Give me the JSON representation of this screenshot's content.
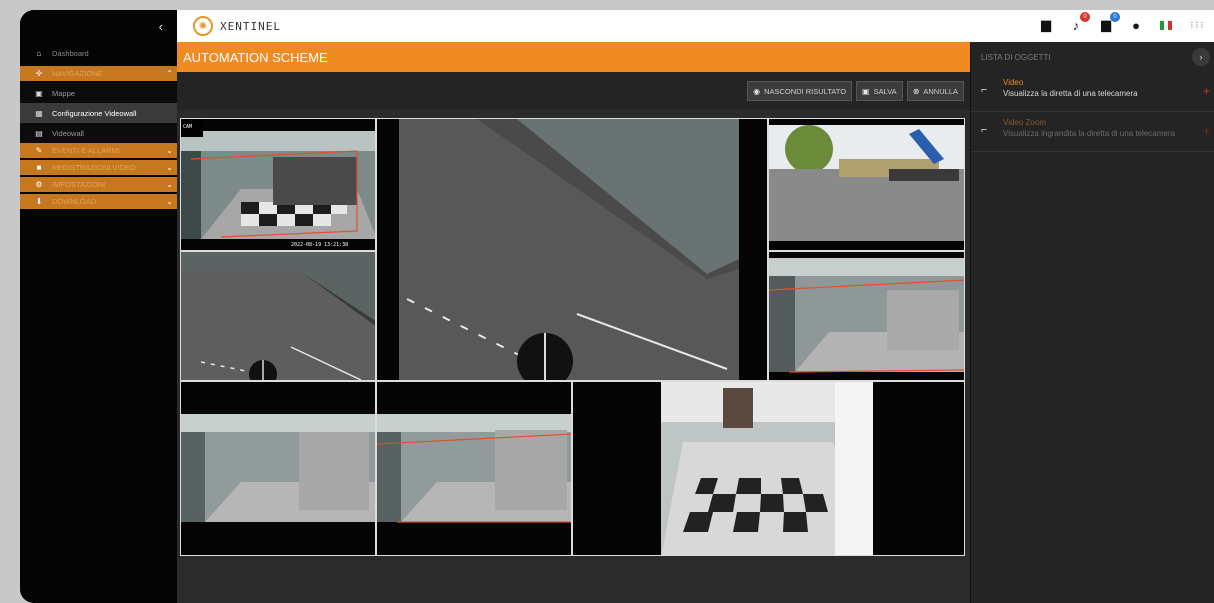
{
  "app": {
    "brand": "XENTINEL",
    "collapse_glyph": "‹"
  },
  "sidebar": {
    "items": [
      {
        "label": "Dashboard",
        "icon": "home-icon",
        "glyph": "⌂",
        "kind": "top"
      },
      {
        "label": "NAVIGAZIONE",
        "icon": "navigation-icon",
        "glyph": "✢",
        "kind": "section",
        "chev": "⌃"
      },
      {
        "label": "Mappe",
        "icon": "map-icon",
        "glyph": "▣",
        "kind": "sub"
      },
      {
        "label": "Configurazione Videowall",
        "icon": "videowall-config-icon",
        "glyph": "▦",
        "kind": "sub-active"
      },
      {
        "label": "Videowall",
        "icon": "videowall-icon",
        "glyph": "▤",
        "kind": "sub"
      },
      {
        "label": "EVENTI E ALLARMI",
        "icon": "events-icon",
        "glyph": "✎",
        "kind": "section",
        "chev": "⌄"
      },
      {
        "label": "REGISTRAZIONI VIDEO",
        "icon": "recordings-icon",
        "glyph": "■",
        "kind": "section",
        "chev": "⌄"
      },
      {
        "label": "IMPOSTAZIONI",
        "icon": "settings-icon",
        "glyph": "⚙",
        "kind": "section",
        "chev": "⌄"
      },
      {
        "label": "DOWNLOAD",
        "icon": "download-icon",
        "glyph": "⬇",
        "kind": "section",
        "chev": "⌄"
      }
    ]
  },
  "header": {
    "icons": [
      {
        "name": "briefcase-icon",
        "glyph": "▆"
      },
      {
        "name": "bell-icon",
        "glyph": "♪",
        "badge": "0",
        "badge_color": "#d9342b"
      },
      {
        "name": "notification-icon",
        "glyph": "▆",
        "badge": "0",
        "badge_color": "#2a78d4"
      },
      {
        "name": "user-icon",
        "glyph": "●"
      },
      {
        "name": "italy-flag-icon",
        "glyph": ""
      },
      {
        "name": "apps-grid-icon",
        "glyph": "⋮⋮⋮"
      }
    ]
  },
  "main": {
    "title": "AUTOMATION SCHEME",
    "buttons": [
      {
        "name": "hide-result-button",
        "icon": "eye-icon",
        "glyph": "◉",
        "label": "NASCONDI RISULTATO"
      },
      {
        "name": "save-button",
        "icon": "save-icon",
        "glyph": "▣",
        "label": "SALVA"
      },
      {
        "name": "cancel-button",
        "icon": "cancel-icon",
        "glyph": "⊗",
        "label": "ANNULLA"
      }
    ],
    "camera_timestamp": "2022-08-19 13:21:38"
  },
  "right_panel": {
    "title": "LISTA DI OGGETTI",
    "expand_glyph": "›",
    "objects": [
      {
        "name": "Video",
        "desc": "Visualizza la diretta di una telecamera",
        "plus": "+"
      },
      {
        "name": "Video Zoom",
        "desc": "Visualizza ingrandita la diretta di una telecamera",
        "plus": "+"
      }
    ]
  },
  "colors": {
    "accent": "#f08a23",
    "sidebar_section": "#c7781f",
    "background": "#2b2b2b"
  }
}
